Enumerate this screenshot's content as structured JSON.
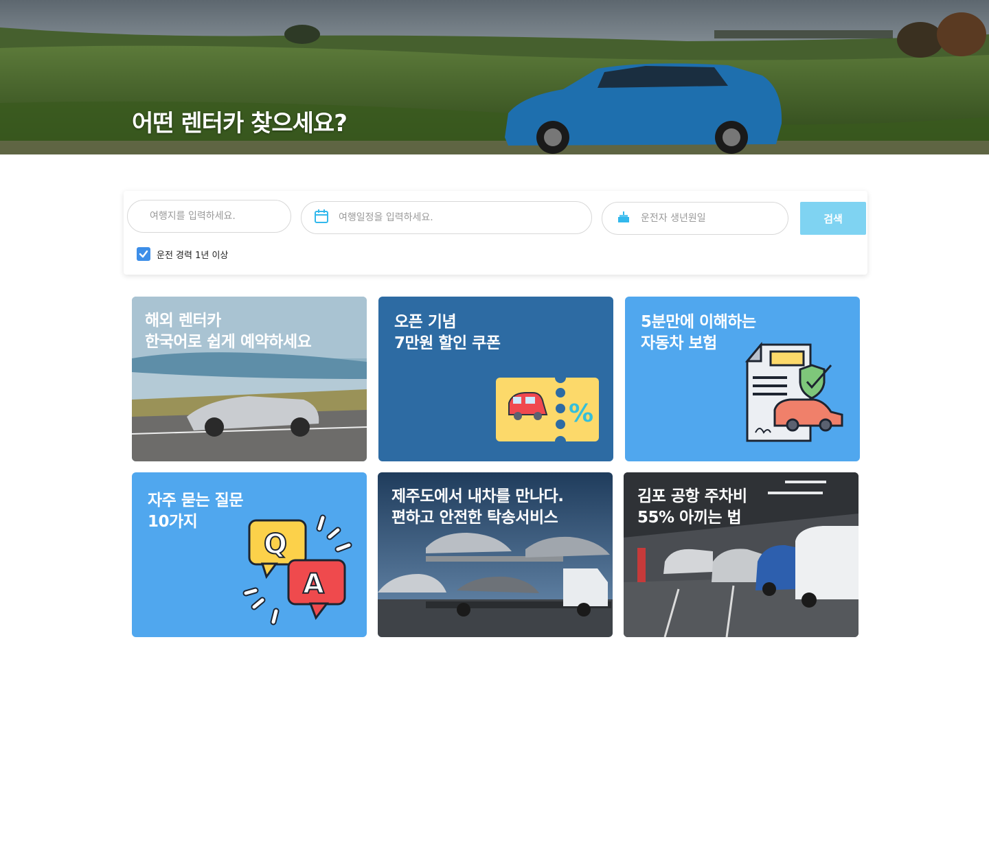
{
  "hero": {
    "title": "어떤 렌터카 찾으세요?"
  },
  "search": {
    "destination_placeholder": "여행지를 입력하세요.",
    "date_placeholder": "여행일정을 입력하세요.",
    "birth_placeholder": "운전자 생년원일",
    "button_label": "검색",
    "experience_label": "운전 경력 1년 이상",
    "experience_checked": true
  },
  "cards": [
    {
      "title": "해외 렌터카\n한국어로 쉽게 예약하세요",
      "bg": "#7aa3b5"
    },
    {
      "title": "오픈 기념\n7만원 할인 쿠폰",
      "bg": "#2d6ba3"
    },
    {
      "title": "5분만에 이해하는\n자동차 보험",
      "bg": "#50a7ee"
    },
    {
      "title": "자주 묻는 질문\n10가지",
      "bg": "#50a7ee"
    },
    {
      "title": "제주도에서 내차를 만나다.\n편하고 안전한 탁송서비스",
      "bg": "#3b5875"
    },
    {
      "title": "김포 공항 주차비\n55% 아끼는 법",
      "bg": "#4a4d52"
    }
  ],
  "icons": {
    "calendar": "calendar-icon",
    "cake": "birthday-cake-icon",
    "check": "check-icon",
    "coupon": "coupon-icon",
    "insurance": "insurance-document-icon",
    "qa": "qa-bubbles-icon"
  },
  "colors": {
    "accent": "#3d8ee8",
    "button": "#7fd3f2",
    "icon": "#32b8ec"
  }
}
